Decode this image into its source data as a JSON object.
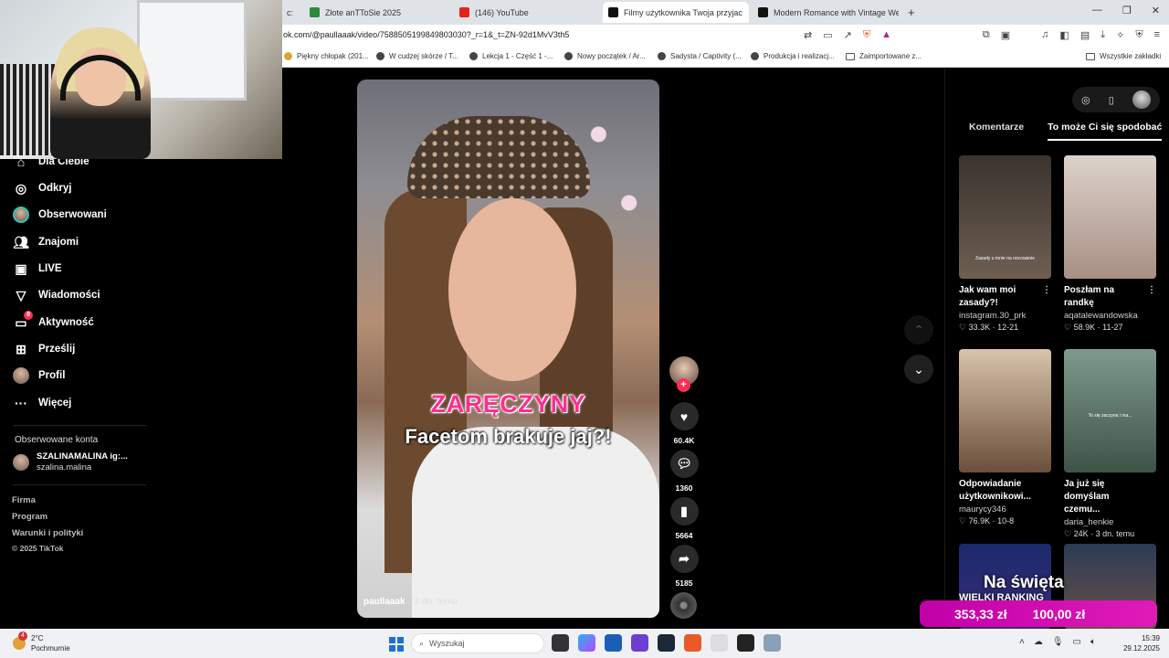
{
  "browser": {
    "tabs": [
      {
        "label": "c:",
        "active": false
      },
      {
        "label": "Złote anTToSie 2025",
        "active": false
      },
      {
        "label": "(146) YouTube",
        "active": false
      },
      {
        "label": "Filmy użytkownika Twoja przyjac",
        "active": true
      },
      {
        "label": "Modern Romance with Vintage Wed",
        "active": false
      }
    ],
    "new_tab": "+",
    "url": "ok.com/@paullaaak/video/7588505199849803030?_r=1&_t=ZN-92d1MvV3th5",
    "bookmarks": [
      "Piękny chłopak (201...",
      "W cudzej skórze / T...",
      "Lekcja 1 - Część 1 -...",
      "Nowy początek / Ar...",
      "Sadysta / Captivity (...",
      "Produkcja i realizacj...",
      "Zaimportowane z...",
      "Wszystkie zakładki"
    ]
  },
  "nav": {
    "items": [
      {
        "label": "Dla Ciebie",
        "icon": "home-icon"
      },
      {
        "label": "Odkryj",
        "icon": "compass-icon"
      },
      {
        "label": "Obserwowani",
        "icon": "avatar"
      },
      {
        "label": "Znajomi",
        "icon": "friends-icon"
      },
      {
        "label": "LIVE",
        "icon": "live-icon"
      },
      {
        "label": "Wiadomości",
        "icon": "send-icon"
      },
      {
        "label": "Aktywność",
        "icon": "activity-icon",
        "badge": "8"
      },
      {
        "label": "Prześlij",
        "icon": "upload-icon"
      },
      {
        "label": "Profil",
        "icon": "avatar"
      },
      {
        "label": "Więcej",
        "icon": "more-icon"
      }
    ],
    "followed_title": "Obserwowane konta",
    "followed": {
      "name": "SZALINAMALINA ig:...",
      "handle": "szalina.malina"
    },
    "footer": [
      "Firma",
      "Program",
      "Warunki i polityki",
      "© 2025 TikTok"
    ]
  },
  "video": {
    "caption_line1": "ZARĘCZYNY",
    "caption_line2": "Facetom brakuje jaj?!",
    "author": "paullaaak",
    "age": "· 2 dn. temu",
    "likes": "60.4K",
    "comments": "1360",
    "saves": "5664",
    "shares": "5185"
  },
  "right_panel": {
    "tabs": [
      "Komentarze",
      "To może Ci się spodobać"
    ],
    "active_tab": 1,
    "cards": [
      {
        "title": "Jak wam moi zasady?!",
        "author": "instagram.30_prk",
        "likes": "33.3K",
        "date": "12-21",
        "thumb_text": "Zasady u mnie na nocowanie",
        "color": "#5a5048"
      },
      {
        "title": "Poszłam na randkę",
        "author": "aqatalewandowska",
        "likes": "58.9K",
        "date": "11-27",
        "thumb_text": "",
        "color": "#c9b6aa"
      },
      {
        "title": "Odpowiadanie użytkownikowi...",
        "author": "maurycy346",
        "likes": "76.9K",
        "date": "10-8",
        "thumb_text": "",
        "color": "#9a7d62"
      },
      {
        "title": "Ja już się domyślam czemu...",
        "author": "daria_henkie",
        "likes": "24K",
        "date": "3 dn. temu",
        "thumb_text": "To się zaczyna i ma...",
        "color": "#5d7a6a"
      }
    ]
  },
  "promo": {
    "title": "Na święta",
    "subtitle": "WIELKI RANKING",
    "amount1": "353,33 zł",
    "amount2": "100,00 zł"
  },
  "taskbar": {
    "weather_temp": "2°C",
    "weather_desc": "Pochmurnie",
    "weather_badge": "4",
    "search_placeholder": "Wyszukaj",
    "time": "15:39",
    "date": "29.12.2025"
  }
}
